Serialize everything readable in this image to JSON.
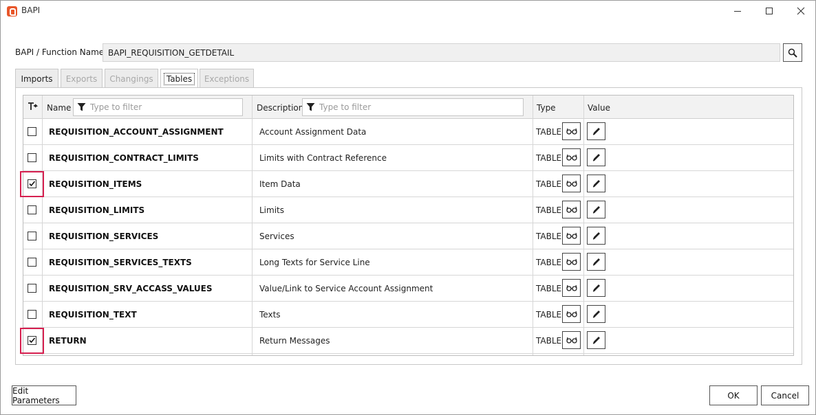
{
  "window": {
    "title": "BAPI"
  },
  "function": {
    "label": "BAPI / Function Name",
    "value": "BAPI_REQUISITION_GETDETAIL"
  },
  "tabs": [
    {
      "label": "Imports",
      "state": "enabled"
    },
    {
      "label": "Exports",
      "state": "disabled"
    },
    {
      "label": "Changings",
      "state": "disabled"
    },
    {
      "label": "Tables",
      "state": "active"
    },
    {
      "label": "Exceptions",
      "state": "disabled"
    }
  ],
  "grid": {
    "headers": {
      "name": "Name",
      "description": "Description",
      "type": "Type",
      "value": "Value"
    },
    "name_filter_placeholder": "Type to filter",
    "description_filter_placeholder": "Type to filter",
    "rows": [
      {
        "checked": false,
        "name": "REQUISITION_ACCOUNT_ASSIGNMENT",
        "description": "Account Assignment Data",
        "type": "TABLE"
      },
      {
        "checked": false,
        "name": "REQUISITION_CONTRACT_LIMITS",
        "description": "Limits with Contract Reference",
        "type": "TABLE"
      },
      {
        "checked": true,
        "name": "REQUISITION_ITEMS",
        "description": "Item Data",
        "type": "TABLE"
      },
      {
        "checked": false,
        "name": "REQUISITION_LIMITS",
        "description": "Limits",
        "type": "TABLE"
      },
      {
        "checked": false,
        "name": "REQUISITION_SERVICES",
        "description": "Services",
        "type": "TABLE"
      },
      {
        "checked": false,
        "name": "REQUISITION_SERVICES_TEXTS",
        "description": "Long Texts for Service Line",
        "type": "TABLE"
      },
      {
        "checked": false,
        "name": "REQUISITION_SRV_ACCASS_VALUES",
        "description": "Value/Link to Service Account Assignment",
        "type": "TABLE"
      },
      {
        "checked": false,
        "name": "REQUISITION_TEXT",
        "description": "Texts",
        "type": "TABLE"
      },
      {
        "checked": true,
        "name": "RETURN",
        "description": "Return Messages",
        "type": "TABLE"
      }
    ]
  },
  "buttons": {
    "edit_parameters": "Edit Parameters",
    "ok": "OK",
    "cancel": "Cancel"
  },
  "colors": {
    "highlight": "#d61f4f",
    "app_icon": "#e8562a"
  }
}
